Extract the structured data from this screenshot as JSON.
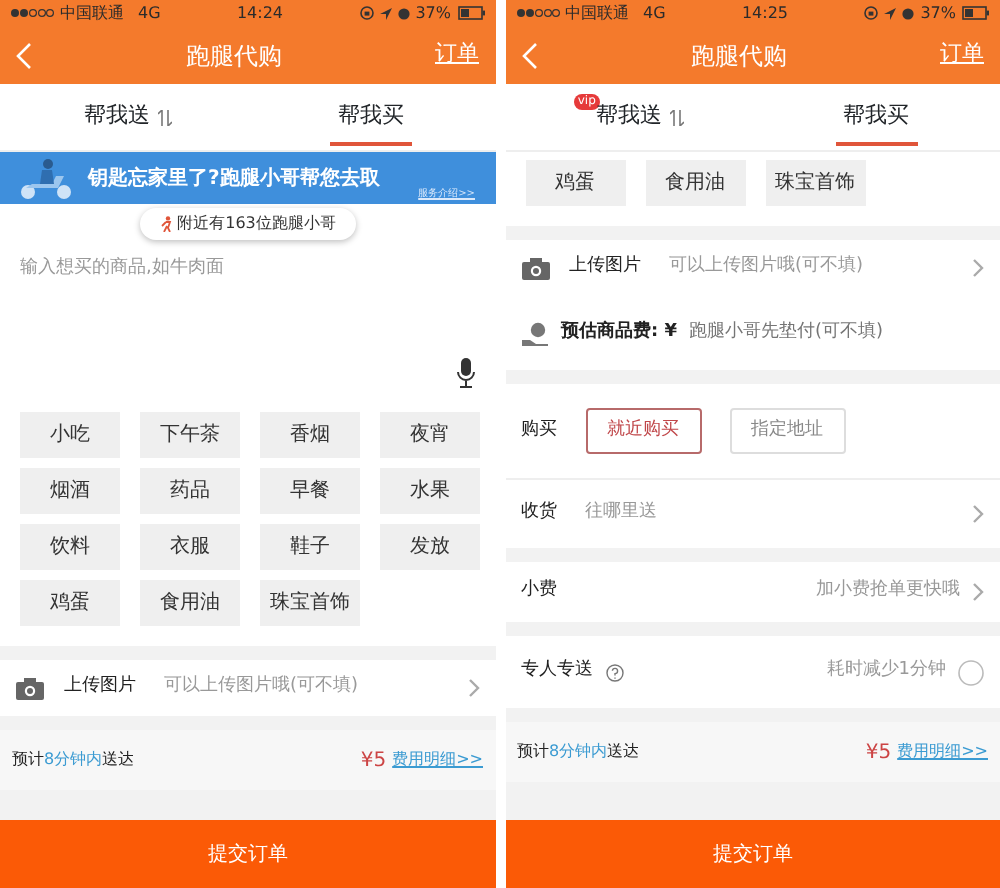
{
  "screens": [
    {
      "status_bar": {
        "carrier": "中国联通",
        "network": "4G",
        "time": "14:24",
        "battery": "37%"
      },
      "header": {
        "title": "跑腿代购",
        "action": "订单"
      },
      "tabs": [
        {
          "label": "帮我送",
          "selected": false,
          "switch_icon": true
        },
        {
          "label": "帮我买",
          "selected": true,
          "switch_icon": false
        }
      ],
      "groups": [
        [
          {
            "kind": "banner",
            "headline": "钥匙忘家里了?跑腿小哥帮您去取",
            "link": "服务介绍>>",
            "nearby": "附近有163位跑腿小哥"
          },
          {
            "kind": "input",
            "placeholder": "输入想买的商品,如牛肉面"
          },
          {
            "kind": "tags",
            "items": [
              "小吃",
              "下午茶",
              "香烟",
              "夜宵",
              "烟酒",
              "药品",
              "早餐",
              "水果",
              "饮料",
              "衣服",
              "鞋子",
              "发放",
              "鸡蛋",
              "食用油",
              "珠宝首饰"
            ]
          }
        ],
        [
          {
            "kind": "upload",
            "label": "上传图片",
            "placeholder": "可以上传图片哦(可不填)"
          }
        ]
      ],
      "estimate": {
        "prefix": "预计",
        "highlight": "8分钟内",
        "suffix": "送达",
        "price": "¥5",
        "link": "费用明细>>"
      },
      "submit": "提交订单"
    },
    {
      "status_bar": {
        "carrier": "中国联通",
        "network": "4G",
        "time": "14:25",
        "battery": "37%"
      },
      "header": {
        "title": "跑腿代购",
        "action": "订单"
      },
      "tabs": [
        {
          "label": "帮我送",
          "selected": false,
          "switch_icon": true,
          "badge": "vip"
        },
        {
          "label": "帮我买",
          "selected": true,
          "switch_icon": false
        }
      ],
      "groups": [
        [
          {
            "kind": "tags",
            "items": [
              "鸡蛋",
              "食用油",
              "珠宝首饰"
            ]
          }
        ],
        [
          {
            "kind": "upload",
            "label": "上传图片",
            "placeholder": "可以上传图片哦(可不填)"
          },
          {
            "kind": "fee",
            "label": "预估商品费: ¥",
            "placeholder": "跑腿小哥先垫付(可不填)"
          }
        ],
        [
          {
            "kind": "buy",
            "label": "购买",
            "options": [
              {
                "label": "就近购买",
                "selected": true
              },
              {
                "label": "指定地址",
                "selected": false
              }
            ]
          },
          {
            "kind": "receive",
            "label": "收货",
            "placeholder": "往哪里送"
          }
        ],
        [
          {
            "kind": "tip",
            "label": "小费",
            "hint": "加小费抢单更快哦"
          }
        ],
        [
          {
            "kind": "express",
            "label": "专人专送",
            "hint": "耗时减少1分钟",
            "checked": false
          }
        ]
      ],
      "estimate": {
        "prefix": "预计",
        "highlight": "8分钟内",
        "suffix": "送达",
        "price": "¥5",
        "link": "费用明细>>"
      },
      "submit": "提交订单"
    }
  ]
}
